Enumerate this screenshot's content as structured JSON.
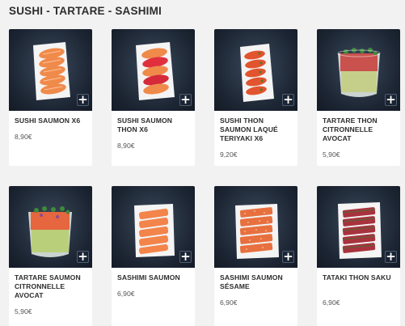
{
  "section": {
    "title": "SUSHI - TARTARE - SASHIMI"
  },
  "products": [
    {
      "name": "SUSHI SAUMON x6",
      "price": "8,90€",
      "icon": "plus-icon"
    },
    {
      "name": "SUSHI SAUMON THON x6",
      "price": "8,90€",
      "icon": "plus-icon"
    },
    {
      "name": "SUSHI THON SAUMON LAQUÉ TERIYAKI x6",
      "price": "9,20€",
      "icon": "plus-icon"
    },
    {
      "name": "TARTARE THON CITRONNELLE AVOCAT",
      "price": "5,90€",
      "icon": "plus-icon"
    },
    {
      "name": "TARTARE SAUMON CITRONNELLE AVOCAT",
      "price": "5,90€",
      "icon": "plus-icon"
    },
    {
      "name": "SASHIMI SAUMON",
      "price": "6,90€",
      "icon": "plus-icon"
    },
    {
      "name": "SASHIMI SAUMON SÉSAME",
      "price": "6,90€",
      "icon": "plus-icon"
    },
    {
      "name": "TATAKI THON SAKU",
      "price": "6,90€",
      "icon": "plus-icon"
    }
  ],
  "colors": {
    "page_bg": "#f2f2f2",
    "card_bg": "#ffffff",
    "photo_bg": "#1c2533",
    "button_bg": "#1b2433"
  },
  "add_symbol": "+"
}
